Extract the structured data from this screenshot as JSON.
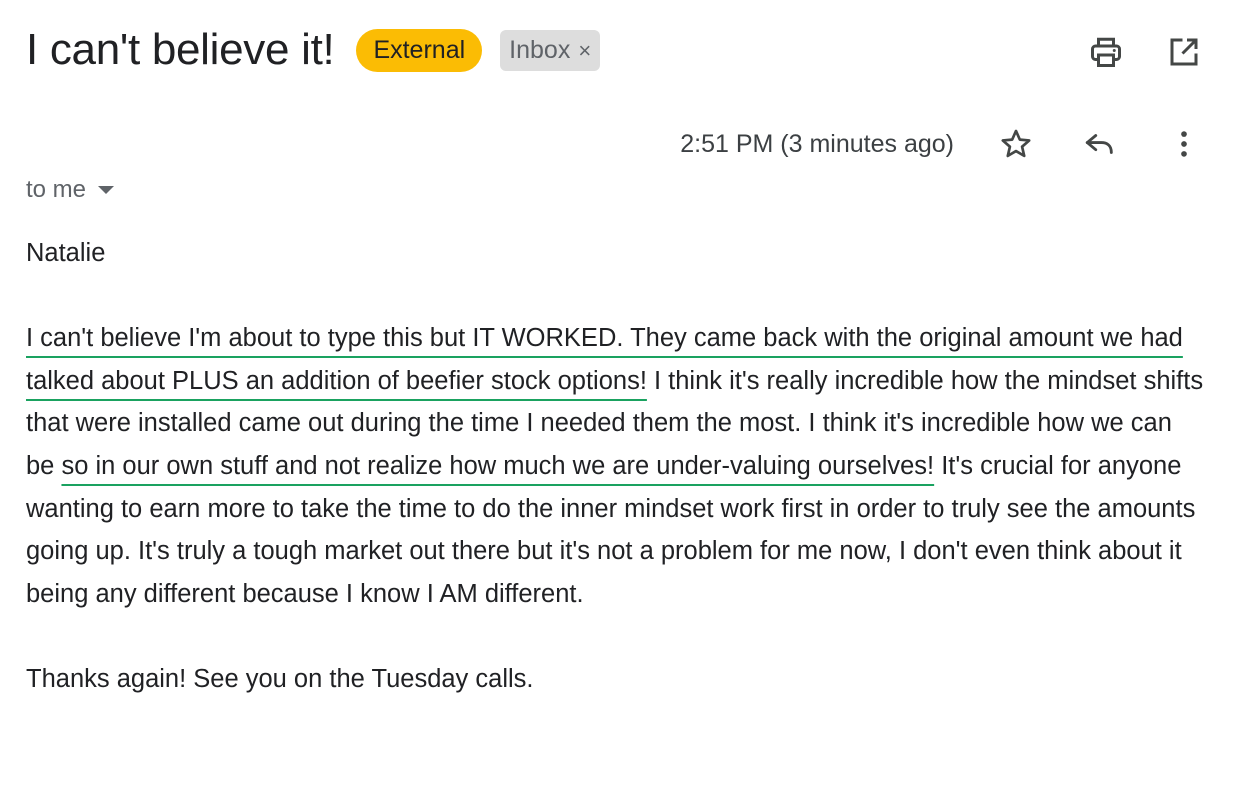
{
  "email": {
    "subject": "I can't believe it!",
    "labels": {
      "external": "External",
      "inbox": "Inbox",
      "inbox_remove": "×"
    },
    "timestamp": "2:51 PM (3 minutes ago)",
    "recipient": "to me",
    "body": {
      "greeting": "Natalie",
      "para1_hl1": "I can't believe I'm about to type this but IT WORKED. They came back with the original amount we had talked about PLUS an addition of beefier stock options!",
      "para1_t1": " I think it's really incredible how the mindset shifts that were installed came out during the time I needed them the most. I think it's incredible how we can be ",
      "para1_hl2": "so in our own stuff and not realize how much we are under-valuing ourselves!",
      "para1_t2": " It's crucial for anyone wanting to earn more to take the time to do the inner mindset work first in order to truly see the amounts going up. It's truly a tough market out there but it's not a problem for me now, I don't even think about it being any different because I know I AM different.",
      "closing": "Thanks again! See you on the Tuesday calls."
    }
  },
  "icons": {
    "print": "print-icon",
    "open_new_window": "open-in-new-icon",
    "star": "star-icon",
    "reply": "reply-icon",
    "more": "more-vert-icon",
    "dropdown": "chevron-down-icon"
  },
  "colors": {
    "external_badge": "#fbbc04",
    "inbox_badge": "#dddddd",
    "highlight_underline": "#1aa260",
    "text": "#202124"
  }
}
